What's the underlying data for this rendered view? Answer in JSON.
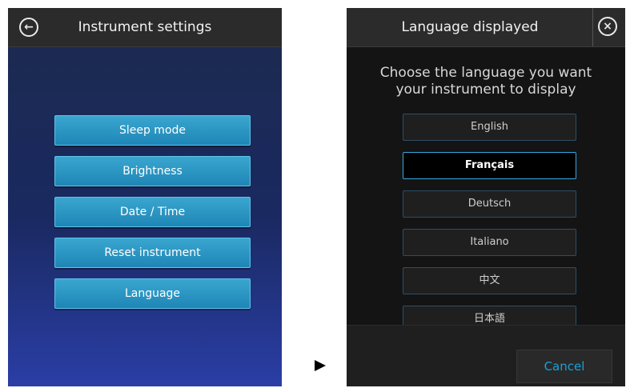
{
  "left_screen": {
    "title": "Instrument settings",
    "back_icon": "back-arrow-icon",
    "menu": [
      {
        "label": "Sleep mode"
      },
      {
        "label": "Brightness"
      },
      {
        "label": "Date / Time"
      },
      {
        "label": "Reset instrument"
      },
      {
        "label": "Language"
      }
    ]
  },
  "transition_icon": "play-arrow-icon",
  "right_screen": {
    "title": "Language displayed",
    "close_icon": "close-circle-icon",
    "prompt": "Choose the language you want your instrument to display",
    "languages": [
      {
        "label": "English"
      },
      {
        "label": "Français",
        "selected": true
      },
      {
        "label": "Deutsch"
      },
      {
        "label": "Italiano"
      },
      {
        "label": "中文"
      },
      {
        "label": "日本語"
      }
    ],
    "cancel_label": "Cancel"
  },
  "colors": {
    "accent": "#37a7e2",
    "button_blue": "#2a96c4",
    "cancel_text": "#18a0d9"
  }
}
